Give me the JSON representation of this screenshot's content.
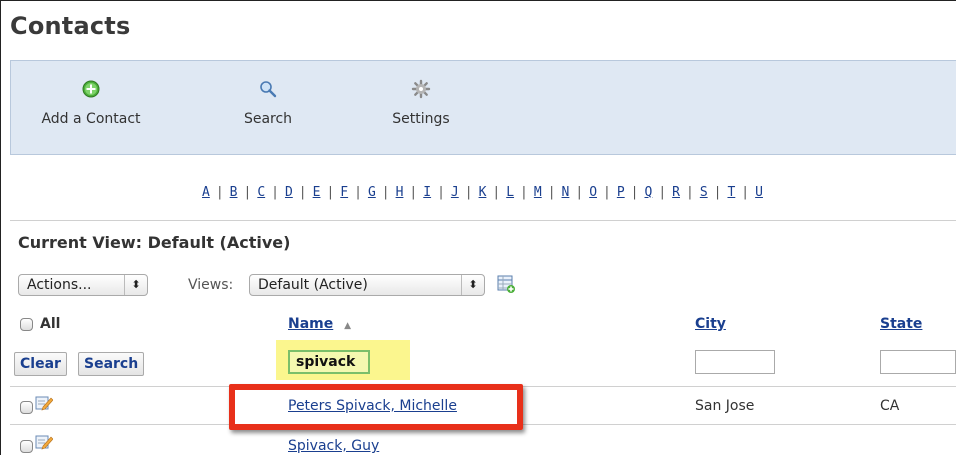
{
  "page": {
    "title": "Contacts"
  },
  "toolbar": {
    "add_label": "Add a Contact",
    "search_label": "Search",
    "settings_label": "Settings"
  },
  "alphabet": [
    "A",
    "B",
    "C",
    "D",
    "E",
    "F",
    "G",
    "H",
    "I",
    "J",
    "K",
    "L",
    "M",
    "N",
    "O",
    "P",
    "Q",
    "R",
    "S",
    "T",
    "U"
  ],
  "view": {
    "current_label": "Current View: Default (Active)",
    "actions_select": "Actions...",
    "views_label": "Views:",
    "views_select": "Default (Active)"
  },
  "table": {
    "all_label": "All",
    "headers": {
      "name": "Name",
      "city": "City",
      "state": "State"
    },
    "sort_indicator": "▲",
    "filter": {
      "clear_label": "Clear",
      "search_label": "Search",
      "name_value": "spivack"
    },
    "rows": [
      {
        "name": "Peters Spivack, Michelle",
        "city": "San Jose",
        "state": "CA"
      },
      {
        "name": "Spivack, Guy",
        "city": "",
        "state": ""
      }
    ]
  },
  "colors": {
    "accent": "#1a3f8f",
    "highlight": "#fbf68e",
    "annotation": "#e8301a",
    "toolbar_bg": "#dfe8f3"
  }
}
